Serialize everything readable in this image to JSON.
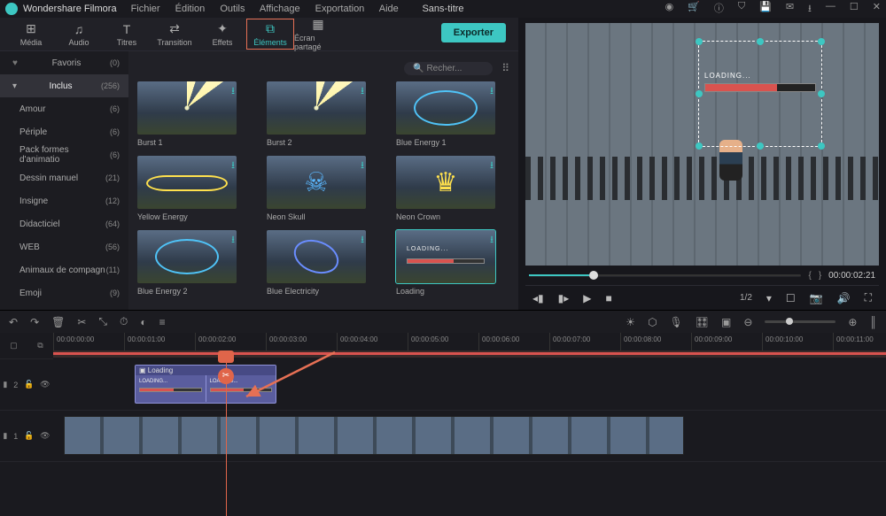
{
  "app_name": "Wondershare Filmora",
  "menu": [
    "Fichier",
    "Édition",
    "Outils",
    "Affichage",
    "Exportation",
    "Aide"
  ],
  "doc_title": "Sans-titre",
  "tabs": [
    {
      "label": "Média",
      "icon": "⊞"
    },
    {
      "label": "Audio",
      "icon": "♫"
    },
    {
      "label": "Titres",
      "icon": "T"
    },
    {
      "label": "Transition",
      "icon": "⇄"
    },
    {
      "label": "Effets",
      "icon": "✦"
    },
    {
      "label": "Éléments",
      "icon": "⧉"
    },
    {
      "label": "Écran partagé",
      "icon": "▦"
    }
  ],
  "export_label": "Exporter",
  "search_placeholder": "Recher...",
  "sidebar": {
    "favorites": {
      "label": "Favoris",
      "count": "(0)"
    },
    "included": {
      "label": "Inclus",
      "count": "(256)"
    },
    "items": [
      {
        "label": "Amour",
        "count": "(6)"
      },
      {
        "label": "Périple",
        "count": "(6)"
      },
      {
        "label": "Pack formes d'animatio",
        "count": "(6)"
      },
      {
        "label": "Dessin manuel",
        "count": "(21)"
      },
      {
        "label": "Insigne",
        "count": "(12)"
      },
      {
        "label": "Didacticiel",
        "count": "(64)"
      },
      {
        "label": "WEB",
        "count": "(56)"
      },
      {
        "label": "Animaux de compagn",
        "count": "(11)"
      },
      {
        "label": "Emoji",
        "count": "(9)"
      }
    ]
  },
  "thumbs": [
    {
      "label": "Burst 1",
      "cls": "burst"
    },
    {
      "label": "Burst 2",
      "cls": "burst"
    },
    {
      "label": "Blue Energy 1",
      "cls": "blueenergy"
    },
    {
      "label": "Yellow Energy",
      "cls": "yellow"
    },
    {
      "label": "Neon Skull",
      "cls": "skull"
    },
    {
      "label": "Neon Crown",
      "cls": "crown"
    },
    {
      "label": "Blue Energy 2",
      "cls": "blueenergy"
    },
    {
      "label": "Blue Electricity",
      "cls": "blueelec"
    },
    {
      "label": "Loading",
      "cls": "loading",
      "selected": true
    }
  ],
  "preview": {
    "loading_text": "LOADING...",
    "time": "00:00:02:21",
    "zoom": "1/2"
  },
  "timeline": {
    "ticks": [
      "00:00:00:00",
      "00:00:01:00",
      "00:00:02:00",
      "00:00:03:00",
      "00:00:04:00",
      "00:00:05:00",
      "00:00:06:00",
      "00:00:07:00",
      "00:00:08:00",
      "00:00:09:00",
      "00:00:10:00",
      "00:00:11:00"
    ],
    "track2": {
      "label": "2",
      "clip_label": "Loading",
      "half_text": "LOADING..."
    },
    "track1": {
      "label": "1"
    }
  }
}
